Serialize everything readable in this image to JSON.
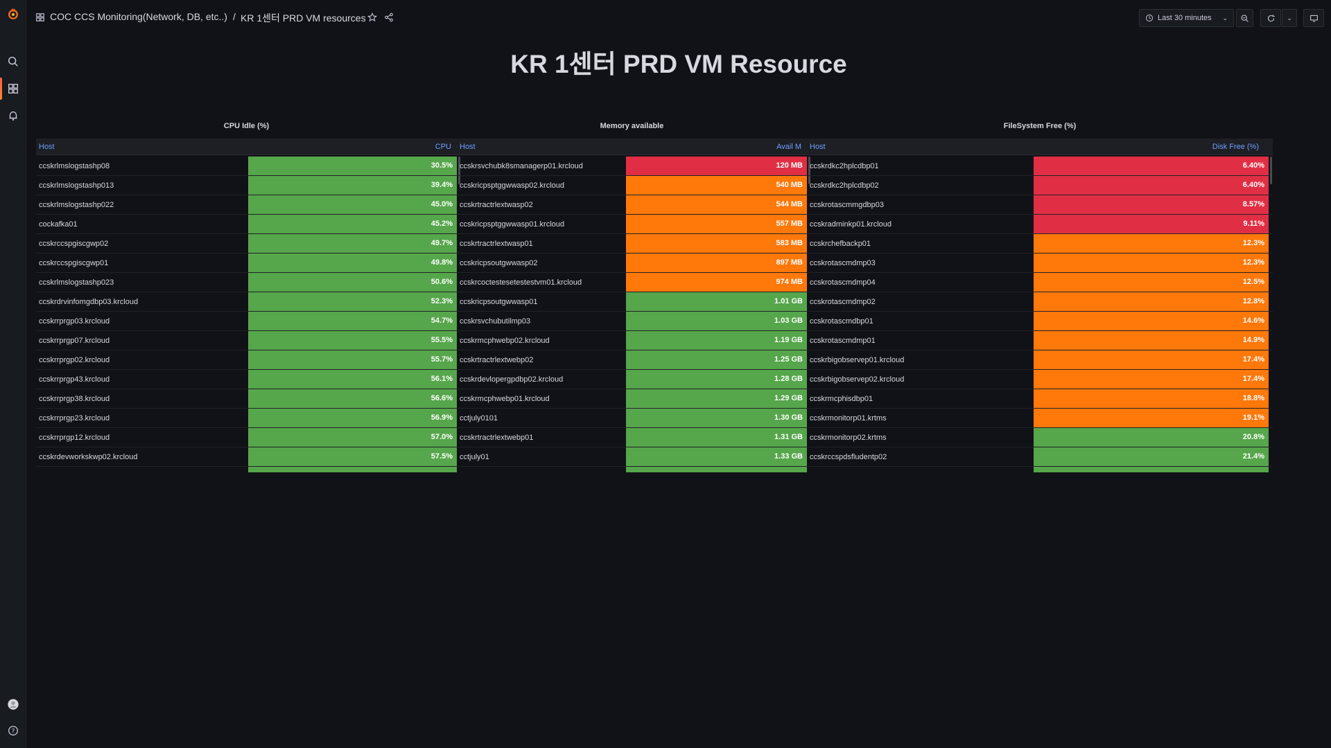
{
  "colors": {
    "ok": "#56a64b",
    "warn": "#ff780a",
    "crit": "#e02f44"
  },
  "breadcrumb": {
    "folder": "COC CCS Monitoring(Network, DB, etc..)",
    "separator": "/",
    "dashboard": "KR 1센터 PRD VM resources"
  },
  "toolbar": {
    "time_range": "Last 30 minutes"
  },
  "title": "KR 1센터 PRD VM Resource",
  "panels": {
    "cpu": {
      "title": "CPU Idle (%)",
      "col_host": "Host",
      "col_value": "CPU",
      "rows": [
        {
          "host": "ccskrlmslogstashp08",
          "value": "30.5%",
          "status": "ok"
        },
        {
          "host": "ccskrlmslogstashp013",
          "value": "39.4%",
          "status": "ok"
        },
        {
          "host": "ccskrlmslogstashp022",
          "value": "45.0%",
          "status": "ok"
        },
        {
          "host": "cockafka01",
          "value": "45.2%",
          "status": "ok"
        },
        {
          "host": "ccskrccspgiscgwp02",
          "value": "49.7%",
          "status": "ok"
        },
        {
          "host": "ccskrccspgiscgwp01",
          "value": "49.8%",
          "status": "ok"
        },
        {
          "host": "ccskrlmslogstashp023",
          "value": "50.6%",
          "status": "ok"
        },
        {
          "host": "ccskrdrvinfomgdbp03.krcloud",
          "value": "52.3%",
          "status": "ok"
        },
        {
          "host": "ccskrrprgp03.krcloud",
          "value": "54.7%",
          "status": "ok"
        },
        {
          "host": "ccskrrprgp07.krcloud",
          "value": "55.5%",
          "status": "ok"
        },
        {
          "host": "ccskrrprgp02.krcloud",
          "value": "55.7%",
          "status": "ok"
        },
        {
          "host": "ccskrrprgp43.krcloud",
          "value": "56.1%",
          "status": "ok"
        },
        {
          "host": "ccskrrprgp38.krcloud",
          "value": "56.6%",
          "status": "ok"
        },
        {
          "host": "ccskrrprgp23.krcloud",
          "value": "56.9%",
          "status": "ok"
        },
        {
          "host": "ccskrrprgp12.krcloud",
          "value": "57.0%",
          "status": "ok"
        },
        {
          "host": "ccskrdevworkskwp02.krcloud",
          "value": "57.5%",
          "status": "ok"
        }
      ]
    },
    "mem": {
      "title": "Memory available",
      "col_host": "Host",
      "col_value": "Avail M",
      "rows": [
        {
          "host": "ccskrsvchubk8smanagerp01.krcloud",
          "value": "120 MB",
          "status": "crit"
        },
        {
          "host": "ccskricpsptggwwasp02.krcloud",
          "value": "540 MB",
          "status": "warn"
        },
        {
          "host": "ccskrtractrlextwasp02",
          "value": "544 MB",
          "status": "warn"
        },
        {
          "host": "ccskricpsptggwwasp01.krcloud",
          "value": "557 MB",
          "status": "warn"
        },
        {
          "host": "ccskrtractrlextwasp01",
          "value": "583 MB",
          "status": "warn"
        },
        {
          "host": "ccskricpsoutgwwasp02",
          "value": "897 MB",
          "status": "warn"
        },
        {
          "host": "ccskrcoctestesetestestvm01.krcloud",
          "value": "974 MB",
          "status": "warn"
        },
        {
          "host": "ccskricpsoutgwwasp01",
          "value": "1.01 GB",
          "status": "ok"
        },
        {
          "host": "ccskrsvchubutilmp03",
          "value": "1.03 GB",
          "status": "ok"
        },
        {
          "host": "ccskrmcphwebp02.krcloud",
          "value": "1.19 GB",
          "status": "ok"
        },
        {
          "host": "ccskrtractrlextwebp02",
          "value": "1.25 GB",
          "status": "ok"
        },
        {
          "host": "ccskrdevlopergpdbp02.krcloud",
          "value": "1.28 GB",
          "status": "ok"
        },
        {
          "host": "ccskrmcphwebp01.krcloud",
          "value": "1.29 GB",
          "status": "ok"
        },
        {
          "host": "cctjuly0101",
          "value": "1.30 GB",
          "status": "ok"
        },
        {
          "host": "ccskrtractrlextwebp01",
          "value": "1.31 GB",
          "status": "ok"
        },
        {
          "host": "cctjuly01",
          "value": "1.33 GB",
          "status": "ok"
        }
      ]
    },
    "disk": {
      "title": "FileSystem Free (%)",
      "col_host": "Host",
      "col_value": "Disk Free (%)",
      "rows": [
        {
          "host": "ccskrdkc2hplcdbp01",
          "value": "6.40%",
          "status": "crit"
        },
        {
          "host": "ccskrdkc2hplcdbp02",
          "value": "6.40%",
          "status": "crit"
        },
        {
          "host": "ccskrotascmmgdbp03",
          "value": "8.57%",
          "status": "crit"
        },
        {
          "host": "ccskradminkp01.krcloud",
          "value": "9.11%",
          "status": "crit"
        },
        {
          "host": "ccskrchefbackp01",
          "value": "12.3%",
          "status": "warn"
        },
        {
          "host": "ccskrotascmdmp03",
          "value": "12.3%",
          "status": "warn"
        },
        {
          "host": "ccskrotascmdmp04",
          "value": "12.5%",
          "status": "warn"
        },
        {
          "host": "ccskrotascmdmp02",
          "value": "12.8%",
          "status": "warn"
        },
        {
          "host": "ccskrotascmdbp01",
          "value": "14.6%",
          "status": "warn"
        },
        {
          "host": "ccskrotascmdmp01",
          "value": "14.9%",
          "status": "warn"
        },
        {
          "host": "ccskrbigobservep01.krcloud",
          "value": "17.4%",
          "status": "warn"
        },
        {
          "host": "ccskrbigobservep02.krcloud",
          "value": "17.4%",
          "status": "warn"
        },
        {
          "host": "ccskrmcphisdbp01",
          "value": "18.8%",
          "status": "warn"
        },
        {
          "host": "ccskrmonitorp01.krtms",
          "value": "19.1%",
          "status": "warn"
        },
        {
          "host": "ccskrmonitorp02.krtms",
          "value": "20.8%",
          "status": "ok"
        },
        {
          "host": "ccskrccspdsfludentp02",
          "value": "21.4%",
          "status": "ok"
        }
      ]
    }
  }
}
